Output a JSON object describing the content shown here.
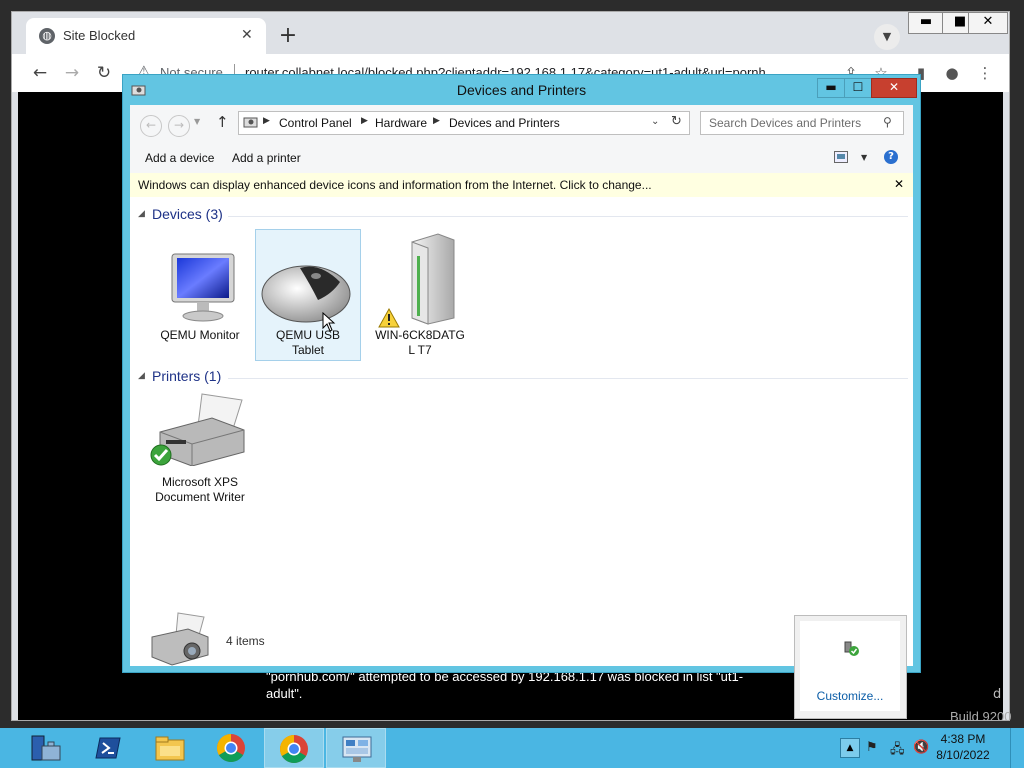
{
  "browser": {
    "tab_title": "Site Blocked",
    "tab_close": "✕",
    "new_tab": "+",
    "security_label": "Not secure",
    "url": "router.collabnet.local/blocked.php?clientaddr=192.168.1.17&category=ut1-adult&url=pornh",
    "window_controls": {
      "minimize": "▬",
      "maximize": "■",
      "close": "✕"
    },
    "page": {
      "block_line1": "\"pornhub.com/\" attempted to be accessed by 192.168.1.17 was blocked in list \"ut1-",
      "block_line2": "adult\".",
      "edge_char": "d"
    }
  },
  "desktop": {
    "build_text": "Build 9200"
  },
  "explorer": {
    "title": "Devices and Printers",
    "window_controls": {
      "minimize": "▬",
      "maximize": "☐",
      "close": "✕"
    },
    "breadcrumb": [
      "Control Panel",
      "Hardware",
      "Devices and Printers"
    ],
    "search_placeholder": "Search Devices and Printers",
    "commands": {
      "add_device": "Add a device",
      "add_printer": "Add a printer"
    },
    "infobar": "Windows can display enhanced device icons and information from the Internet. Click to change...",
    "infobar_close": "✕",
    "groups": {
      "devices": {
        "title": "Devices (3)"
      },
      "printers": {
        "title": "Printers (1)"
      }
    },
    "devices": [
      {
        "label": "QEMU Monitor"
      },
      {
        "label": "QEMU USB Tablet"
      },
      {
        "label": "WIN-6CK8DATGL T7"
      }
    ],
    "printers": [
      {
        "label": "Microsoft XPS Document Writer"
      }
    ],
    "status": {
      "count": "4 items"
    }
  },
  "tray_popup": {
    "customize": "Customize..."
  },
  "taskbar": {
    "time": "4:38 PM",
    "date": "8/10/2022"
  },
  "colors": {
    "window_frame": "#62c5e2",
    "taskbar": "#4ab6e3",
    "group_title": "#1e3287",
    "infobar_bg": "#ffffe1"
  }
}
